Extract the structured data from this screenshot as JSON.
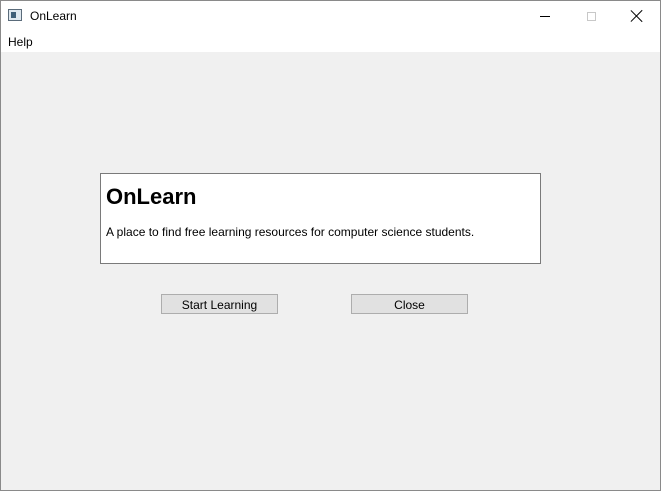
{
  "window": {
    "title": "OnLearn",
    "icon": "app-window-icon",
    "controls": {
      "minimize": "minimize-icon",
      "maximize": "maximize-icon",
      "close": "close-icon"
    }
  },
  "menubar": {
    "items": [
      {
        "label": "Help"
      }
    ]
  },
  "panel": {
    "title": "OnLearn",
    "description": "A place to find free learning resources for computer science students."
  },
  "buttons": {
    "start_label": "Start Learning",
    "close_label": "Close"
  },
  "colors": {
    "window_background": "#f0f0f0",
    "titlebar_background": "#ffffff",
    "panel_background": "#ffffff",
    "button_background": "#e1e1e1",
    "button_border": "#adadad"
  }
}
